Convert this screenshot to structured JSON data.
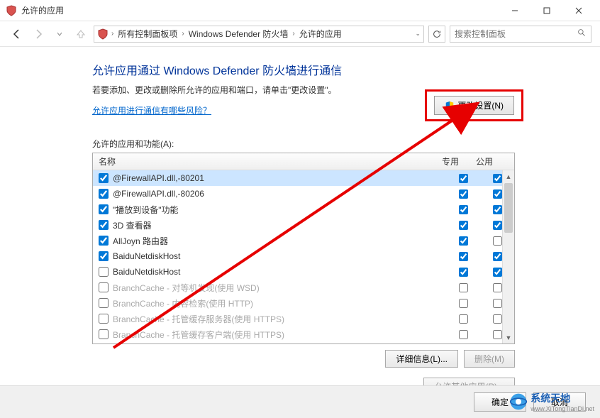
{
  "window": {
    "title": "允许的应用"
  },
  "breadcrumb": {
    "item1": "所有控制面板项",
    "item2": "Windows Defender 防火墙",
    "item3": "允许的应用"
  },
  "search": {
    "placeholder": "搜索控制面板"
  },
  "page": {
    "heading": "允许应用通过 Windows Defender 防火墙进行通信",
    "sub": "若要添加、更改或删除所允许的应用和端口，请单击\"更改设置\"。",
    "risk_link": "允许应用进行通信有哪些风险？",
    "change_settings": "更改设置(N)",
    "list_label": "允许的应用和功能(A):",
    "col_name": "名称",
    "col_private": "专用",
    "col_public": "公用",
    "details_btn": "详细信息(L)...",
    "remove_btn": "删除(M)",
    "allow_other_btn": "允许其他应用(R)...",
    "ok_btn": "确定",
    "cancel_btn": "取消"
  },
  "rows": [
    {
      "checked": true,
      "name": "@FirewallAPI.dll,-80201",
      "private": true,
      "public": true,
      "selected": true
    },
    {
      "checked": true,
      "name": "@FirewallAPI.dll,-80206",
      "private": true,
      "public": true
    },
    {
      "checked": true,
      "name": "\"播放到设备\"功能",
      "private": true,
      "public": true
    },
    {
      "checked": true,
      "name": "3D 查看器",
      "private": true,
      "public": true
    },
    {
      "checked": true,
      "name": "AllJoyn 路由器",
      "private": true,
      "public": false
    },
    {
      "checked": true,
      "name": "BaiduNetdiskHost",
      "private": true,
      "public": true
    },
    {
      "checked": false,
      "name": "BaiduNetdiskHost",
      "private": true,
      "public": true
    },
    {
      "checked": false,
      "name": "BranchCache - 对等机发现(使用 WSD)",
      "private": false,
      "public": false,
      "disabled": true
    },
    {
      "checked": false,
      "name": "BranchCache - 内容检索(使用 HTTP)",
      "private": false,
      "public": false,
      "disabled": true
    },
    {
      "checked": false,
      "name": "BranchCache - 托管缓存服务器(使用 HTTPS)",
      "private": false,
      "public": false,
      "disabled": true
    },
    {
      "checked": false,
      "name": "BranchCache - 托管缓存客户端(使用 HTTPS)",
      "private": false,
      "public": false,
      "disabled": true
    }
  ],
  "watermark": {
    "name": "系统天地",
    "url": "www.XiTongTianDi.net"
  }
}
